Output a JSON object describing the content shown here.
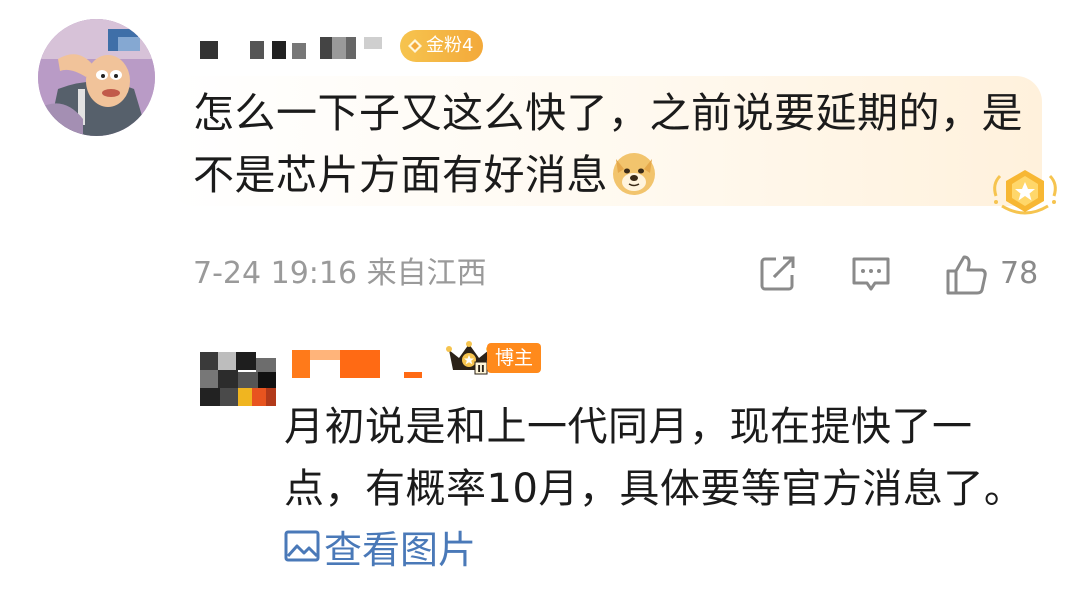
{
  "comment": {
    "badge_label": "金粉4",
    "text_line1": "怎么一下子又这么快了，之前说要延期的，是",
    "text_line2": "不是芯片方面有好消息",
    "timestamp": "7-24 19:16",
    "location": "来自江西",
    "like_count": "78"
  },
  "reply": {
    "badge_label": "博主",
    "crown_level": "II",
    "text_line1": "月初说是和上一代同月，现在提快了一",
    "text_line2": "点，有概率10月，具体要等官方消息了。",
    "view_image_label": "查看图片"
  },
  "icons": {
    "share": "share-icon",
    "comment": "comment-icon",
    "like": "like-icon",
    "image": "image-icon",
    "doge": "doge-emoji-icon"
  },
  "colors": {
    "link": "#4a79b8",
    "meta": "#9a9a9a",
    "badge_gold": "#f3a93a",
    "host_orange": "#ff8a1c"
  }
}
